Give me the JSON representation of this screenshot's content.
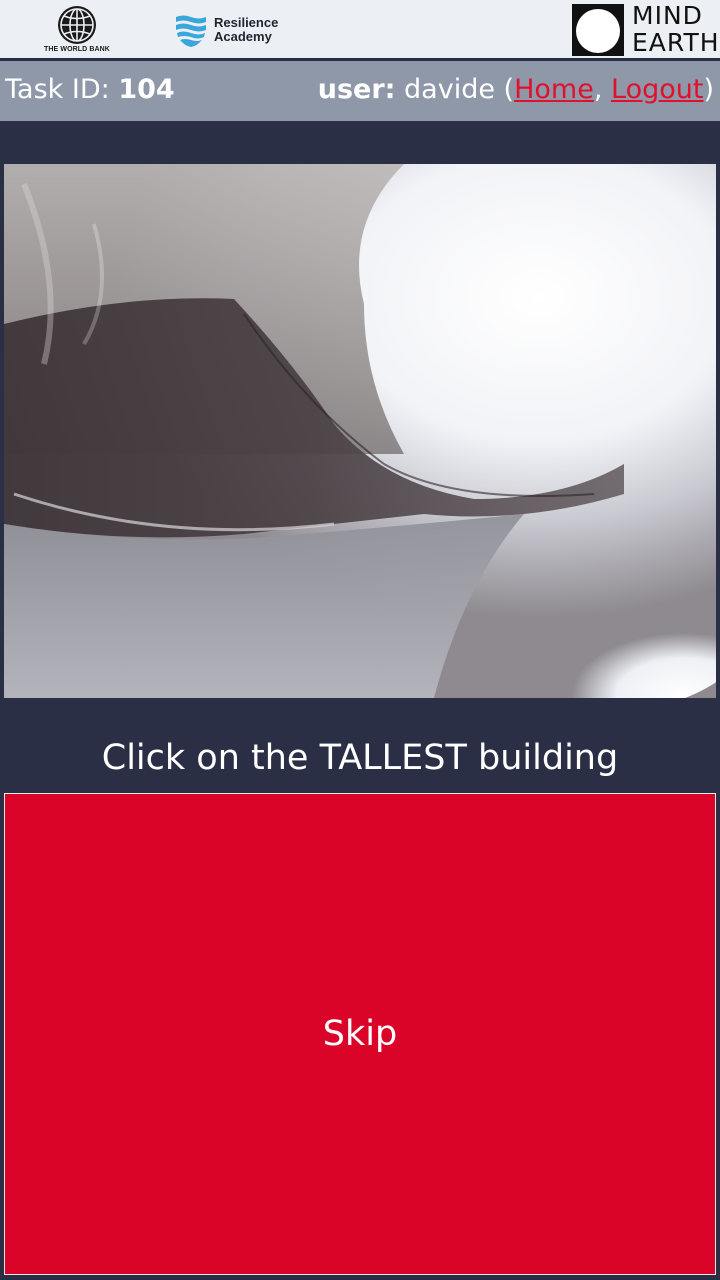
{
  "logos": {
    "world_bank": {
      "text": "THE WORLD BANK",
      "icon": "globe-icon"
    },
    "resilience_academy": {
      "line1": "Resilience",
      "line2": "Academy",
      "icon": "waves-shield-icon",
      "color": "#3aa6dc"
    },
    "mind_earth": {
      "line1": "MIND",
      "line2": "EARTH"
    }
  },
  "info_bar": {
    "task_label": "Task ID:",
    "task_id": "104",
    "user_label": "user:",
    "username": "davide",
    "home_link": "Home",
    "logout_link": "Logout",
    "link_color": "#e0102e"
  },
  "prompt": "Click on the TALLEST building",
  "skip_label": "Skip",
  "colors": {
    "background": "#2b2f45",
    "info_bar": "#8f98a9",
    "skip": "#da0429"
  }
}
